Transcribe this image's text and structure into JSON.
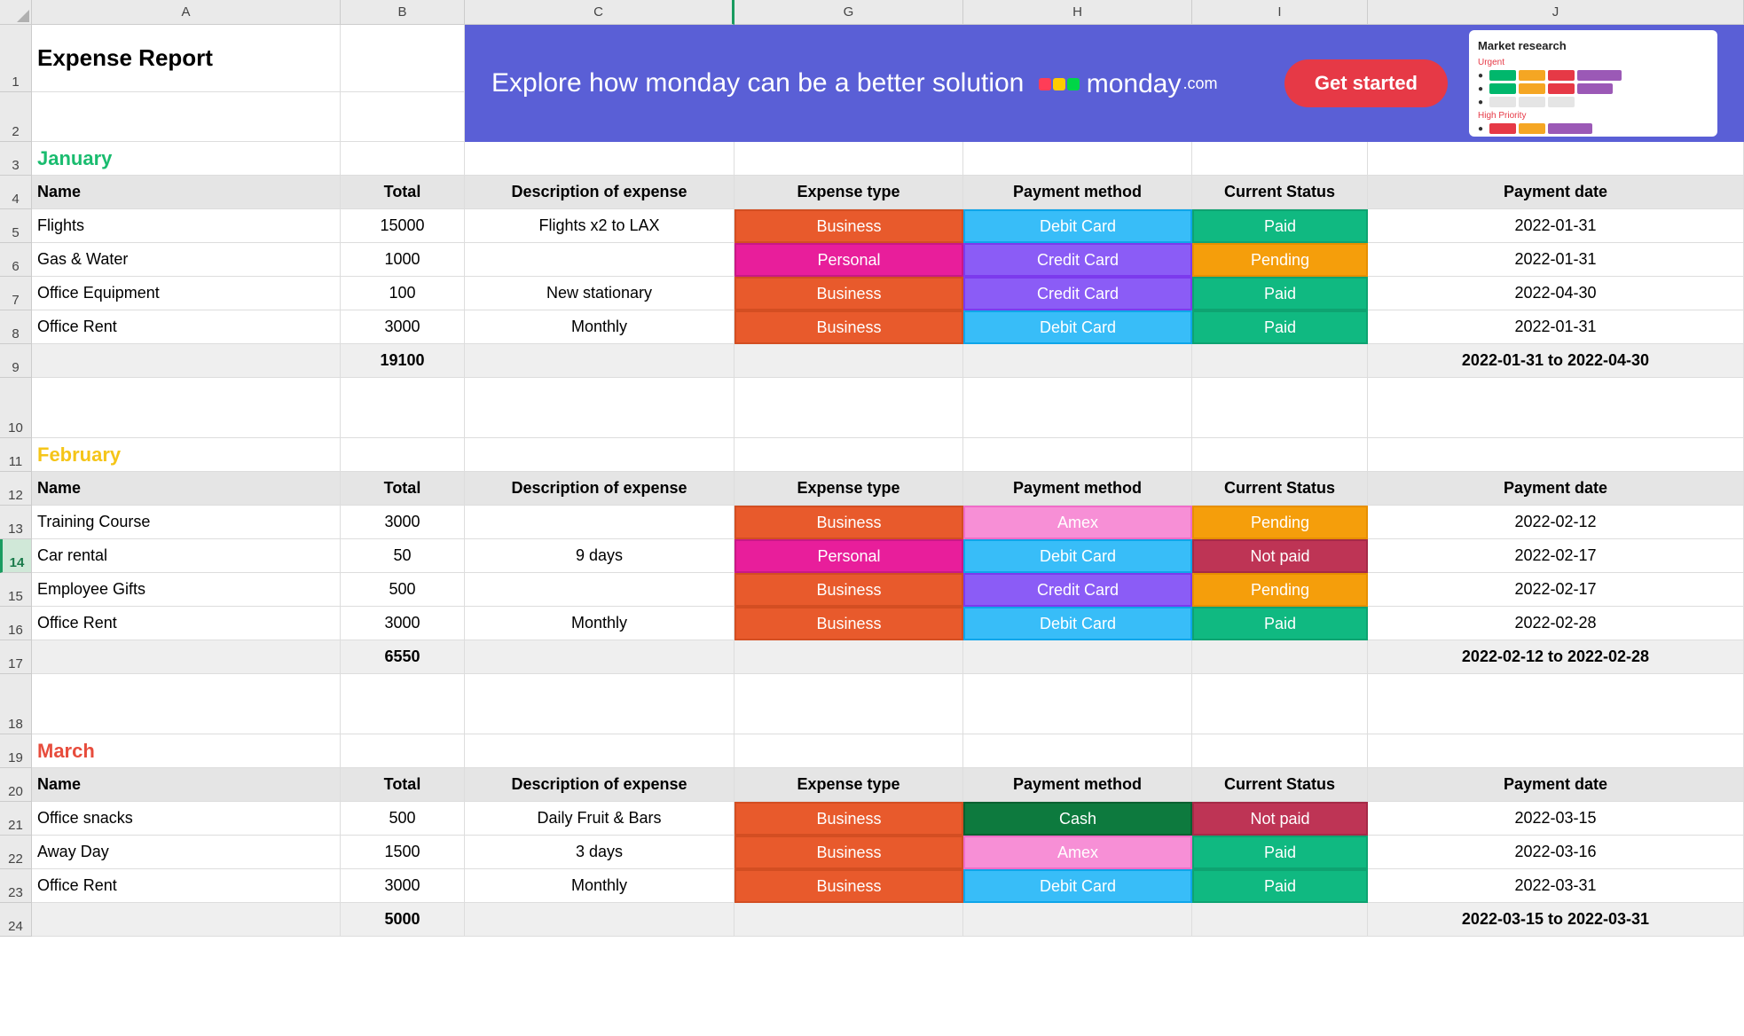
{
  "columns": [
    "A",
    "B",
    "C",
    "G",
    "H",
    "I",
    "J"
  ],
  "row_numbers": [
    "1",
    "2",
    "3",
    "4",
    "5",
    "6",
    "7",
    "8",
    "9",
    "10",
    "11",
    "12",
    "13",
    "14",
    "15",
    "16",
    "17",
    "18",
    "19",
    "20",
    "21",
    "22",
    "23",
    "24"
  ],
  "title": "Expense Report",
  "banner": {
    "headline": "Explore how monday can be a better solution",
    "brand": "monday",
    "brand_suffix": ".com",
    "cta": "Get started",
    "mock_title": "Market research",
    "mock_label1": "Urgent",
    "mock_label2": "High Priority"
  },
  "headers": {
    "name": "Name",
    "total": "Total",
    "desc": "Description of expense",
    "type": "Expense type",
    "method": "Payment method",
    "status": "Current Status",
    "date": "Payment date"
  },
  "tags": {
    "business": "Business",
    "personal": "Personal",
    "debit": "Debit Card",
    "credit": "Credit Card",
    "amex": "Amex",
    "cash": "Cash",
    "paid": "Paid",
    "pending": "Pending",
    "notpaid": "Not paid"
  },
  "months": {
    "jan": {
      "label": "January",
      "rows": [
        {
          "name": "Flights",
          "total": "15000",
          "desc": "Flights x2 to LAX",
          "type": "business",
          "method": "debit",
          "status": "paid",
          "date": "2022-01-31"
        },
        {
          "name": "Gas & Water",
          "total": "1000",
          "desc": "",
          "type": "personal",
          "method": "credit",
          "status": "pending",
          "date": "2022-01-31"
        },
        {
          "name": "Office Equipment",
          "total": "100",
          "desc": "New stationary",
          "type": "business",
          "method": "credit",
          "status": "paid",
          "date": "2022-04-30"
        },
        {
          "name": "Office Rent",
          "total": "3000",
          "desc": "Monthly",
          "type": "business",
          "method": "debit",
          "status": "paid",
          "date": "2022-01-31"
        }
      ],
      "sum": "19100",
      "range": "2022-01-31 to 2022-04-30"
    },
    "feb": {
      "label": "February",
      "rows": [
        {
          "name": "Training Course",
          "total": "3000",
          "desc": "",
          "type": "business",
          "method": "amex",
          "status": "pending",
          "date": "2022-02-12"
        },
        {
          "name": "Car rental",
          "total": "50",
          "desc": "9 days",
          "type": "personal",
          "method": "debit",
          "status": "notpaid",
          "date": "2022-02-17"
        },
        {
          "name": "Employee Gifts",
          "total": "500",
          "desc": "",
          "type": "business",
          "method": "credit",
          "status": "pending",
          "date": "2022-02-17"
        },
        {
          "name": "Office Rent",
          "total": "3000",
          "desc": "Monthly",
          "type": "business",
          "method": "debit",
          "status": "paid",
          "date": "2022-02-28"
        }
      ],
      "sum": "6550",
      "range": "2022-02-12 to 2022-02-28"
    },
    "mar": {
      "label": "March",
      "rows": [
        {
          "name": "Office snacks",
          "total": "500",
          "desc": "Daily Fruit & Bars",
          "type": "business",
          "method": "cash",
          "status": "notpaid",
          "date": "2022-03-15"
        },
        {
          "name": "Away Day",
          "total": "1500",
          "desc": "3 days",
          "type": "business",
          "method": "amex",
          "status": "paid",
          "date": "2022-03-16"
        },
        {
          "name": "Office Rent",
          "total": "3000",
          "desc": "Monthly",
          "type": "business",
          "method": "debit",
          "status": "paid",
          "date": "2022-03-31"
        }
      ],
      "sum": "5000",
      "range": "2022-03-15 to 2022-03-31"
    }
  }
}
